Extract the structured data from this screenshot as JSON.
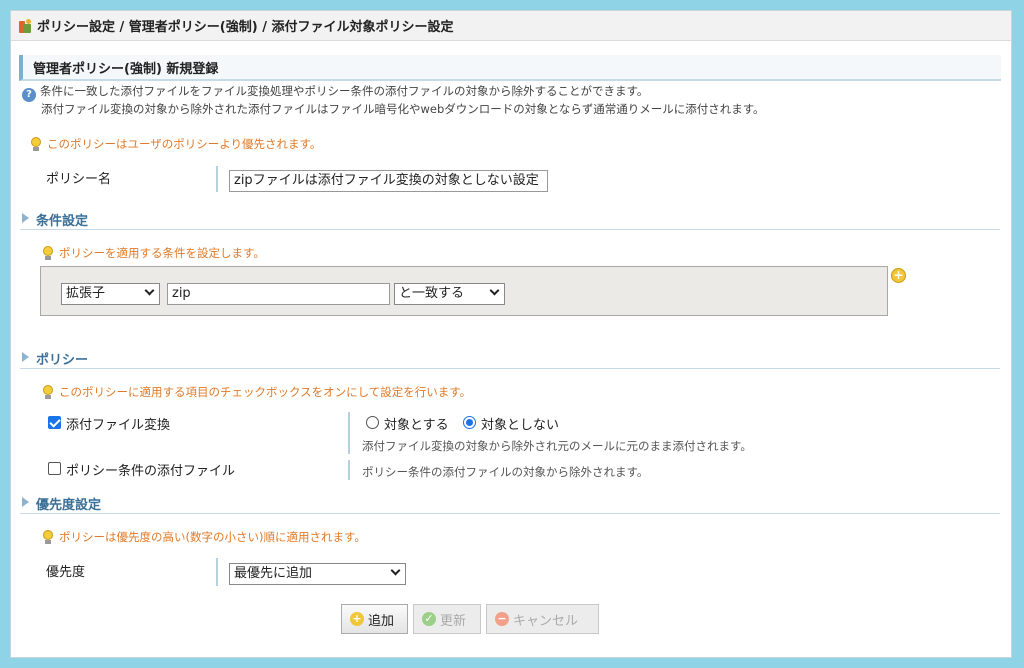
{
  "breadcrumb": "ポリシー設定 / 管理者ポリシー(強制) / 添付ファイル対象ポリシー設定",
  "page_title": "管理者ポリシー(強制) 新規登録",
  "description": {
    "line1": "条件に一致した添付ファイルをファイル変換処理やポリシー条件の添付ファイルの対象から除外することができます。",
    "line2": "添付ファイル変換の対象から除外された添付ファイルはファイル暗号化やwebダウンロードの対象とならず通常通りメールに添付されます。"
  },
  "priority_note": "このポリシーはユーザのポリシーより優先されます。",
  "policy_name": {
    "label": "ポリシー名",
    "value": "zipファイルは添付ファイル変換の対象としない設定"
  },
  "condition_section": {
    "title": "条件設定",
    "note": "ポリシーを適用する条件を設定します。",
    "field_select": "拡張子",
    "value": "zip",
    "match_select": "と一致する"
  },
  "policy_section": {
    "title": "ポリシー",
    "note": "このポリシーに適用する項目のチェックボックスをオンにして設定を行います。",
    "item1": {
      "label": "添付ファイル変換",
      "checked": true,
      "radio_on": "対象とする",
      "radio_off": "対象としない",
      "selected": "対象としない",
      "help": "添付ファイル変換の対象から除外され元のメールに元のまま添付されます。"
    },
    "item2": {
      "label": "ポリシー条件の添付ファイル",
      "checked": false,
      "help": "ポリシー条件の添付ファイルの対象から除外されます。"
    }
  },
  "priority_section": {
    "title": "優先度設定",
    "note": "ポリシーは優先度の高い(数字の小さい)順に適用されます。",
    "label": "優先度",
    "select": "最優先に追加"
  },
  "buttons": {
    "add": "追加",
    "update": "更新",
    "cancel": "キャンセル"
  }
}
